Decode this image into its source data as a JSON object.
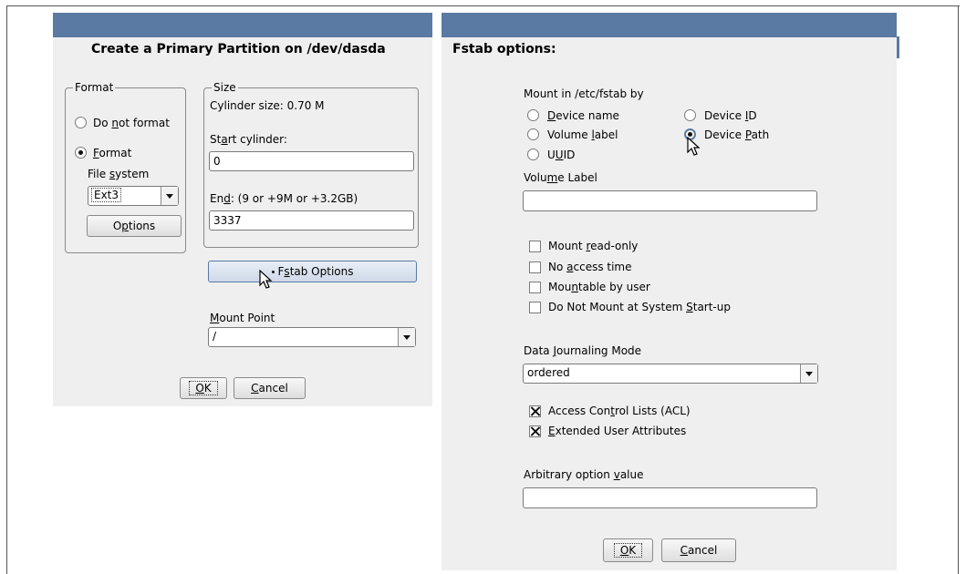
{
  "left_dialog": {
    "title": "Create a Primary Partition on /dev/dasda",
    "format_group": {
      "legend": "Format",
      "do_not_format_pre": "Do ",
      "do_not_format_u": "n",
      "do_not_format_post": "ot format",
      "format_u": "F",
      "format_post": "ormat",
      "file_system_pre": "File ",
      "file_system_u": "s",
      "file_system_post": "ystem",
      "file_system_value": "Ext3",
      "options_pre": "O",
      "options_u": "p",
      "options_post": "tions"
    },
    "size_group": {
      "legend": "Size",
      "cylinder_size": "Cylinder size: 0.70 M",
      "start_label_pre": "St",
      "start_label_u": "a",
      "start_label_post": "rt cylinder:",
      "start_value": "0",
      "end_label_pre": "En",
      "end_label_u": "d",
      "end_label_post": ":  (9 or +9M or +3.2GB)",
      "end_value": "3337"
    },
    "fstab_button_pre": "F",
    "fstab_button_u": "s",
    "fstab_button_post": "tab Options",
    "mount_point_u": "M",
    "mount_point_post": "ount Point",
    "mount_point_value": "/",
    "ok_u": "O",
    "ok_post": "K",
    "cancel_u": "C",
    "cancel_post": "ancel"
  },
  "right_dialog": {
    "title": "Fstab options:",
    "mount_by_label": "Mount in /etc/fstab by",
    "radios": {
      "device_name_u": "D",
      "device_name_post": "evice name",
      "device_id_pre": "Device ",
      "device_id_u": "I",
      "device_id_post": "D",
      "volume_label_pre": "Volume ",
      "volume_label_u": "l",
      "volume_label_post": "abel",
      "device_path_pre": "Device ",
      "device_path_u": "P",
      "device_path_post": "ath",
      "uuid_pre": "U",
      "uuid_u": "U",
      "uuid_post": "ID"
    },
    "volume_label_field_pre": "Volu",
    "volume_label_field_u": "m",
    "volume_label_field_post": "e Label",
    "volume_label_value": "",
    "checks": {
      "read_only_pre": "Mount ",
      "read_only_u": "r",
      "read_only_post": "ead-only",
      "no_access_pre": "No ",
      "no_access_u": "a",
      "no_access_post": "ccess time",
      "mountable_pre": "Mou",
      "mountable_u": "n",
      "mountable_post": "table by user",
      "no_mount_pre": "Do Not Mount at System ",
      "no_mount_u": "S",
      "no_mount_post": "tart-up"
    },
    "journal_label_pre": "Data ",
    "journal_label_u": "J",
    "journal_label_post": "ournaling Mode",
    "journal_value": "ordered",
    "acl_pre": "Access Con",
    "acl_u": "t",
    "acl_post": "rol Lists (ACL)",
    "ext_u": "E",
    "ext_post": "xtended User Attributes",
    "arbitrary_pre": "Arbitrary option ",
    "arbitrary_u": "v",
    "arbitrary_post": "alue",
    "arbitrary_value": "",
    "ok_u": "O",
    "ok_post": "K",
    "cancel_u": "C",
    "cancel_post": "ancel"
  },
  "colors": {
    "titlebar": "#5a7aa3",
    "dialog_bg": "#efefef"
  }
}
